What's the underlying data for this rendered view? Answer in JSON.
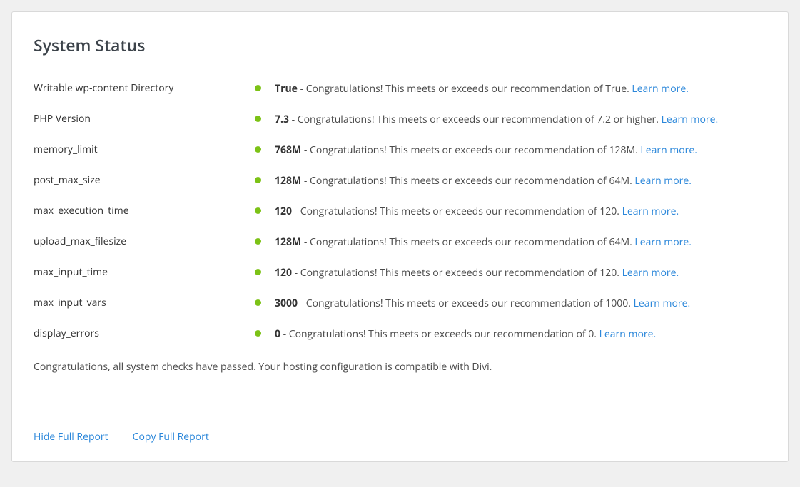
{
  "title": "System Status",
  "items": [
    {
      "label": "Writable wp-content Directory",
      "value": "True",
      "msg": " - Congratulations! This meets or exceeds our recommendation of True. ",
      "learn": "Learn more."
    },
    {
      "label": "PHP Version",
      "value": "7.3",
      "msg": " - Congratulations! This meets or exceeds our recommendation of 7.2 or higher. ",
      "learn": "Learn more."
    },
    {
      "label": "memory_limit",
      "value": "768M",
      "msg": " - Congratulations! This meets or exceeds our recommendation of 128M. ",
      "learn": "Learn more."
    },
    {
      "label": "post_max_size",
      "value": "128M",
      "msg": " - Congratulations! This meets or exceeds our recommendation of 64M. ",
      "learn": "Learn more."
    },
    {
      "label": "max_execution_time",
      "value": "120",
      "msg": " - Congratulations! This meets or exceeds our recommendation of 120. ",
      "learn": "Learn more."
    },
    {
      "label": "upload_max_filesize",
      "value": "128M",
      "msg": " - Congratulations! This meets or exceeds our recommendation of 64M. ",
      "learn": "Learn more."
    },
    {
      "label": "max_input_time",
      "value": "120",
      "msg": " - Congratulations! This meets or exceeds our recommendation of 120. ",
      "learn": "Learn more."
    },
    {
      "label": "max_input_vars",
      "value": "3000",
      "msg": " - Congratulations! This meets or exceeds our recommendation of 1000. ",
      "learn": "Learn more."
    },
    {
      "label": "display_errors",
      "value": "0",
      "msg": " - Congratulations! This meets or exceeds our recommendation of 0. ",
      "learn": "Learn more."
    }
  ],
  "summary": "Congratulations, all system checks have passed. Your hosting configuration is compatible with Divi.",
  "footer": {
    "hide": "Hide Full Report",
    "copy": "Copy Full Report"
  }
}
